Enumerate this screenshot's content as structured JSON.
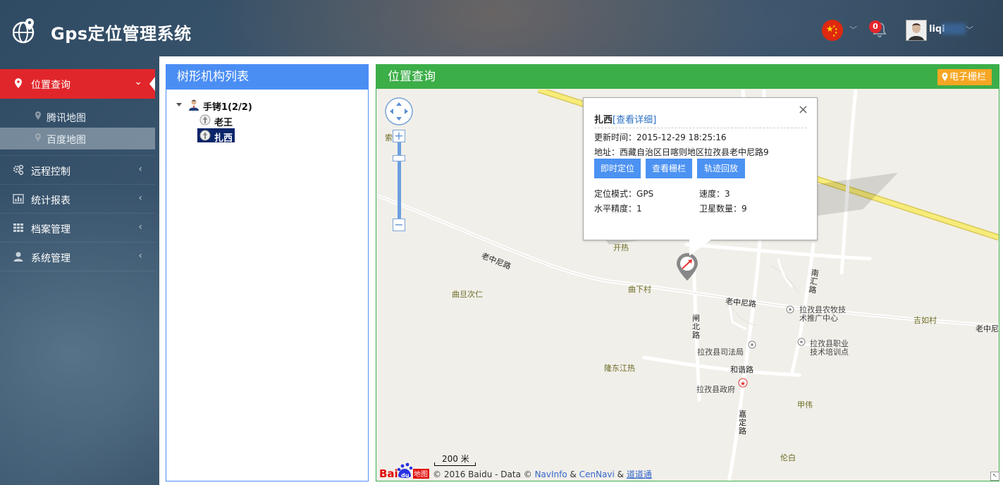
{
  "header": {
    "title": "Gps定位管理系统",
    "notification_count": "0",
    "user_name": "liqi",
    "icons": {
      "logo": "globe-pin-icon",
      "language": "china-flag-icon",
      "notifications": "bell-icon"
    }
  },
  "sidebar": {
    "items": [
      {
        "label": "位置查询",
        "icon": "map-marker-icon",
        "active": true,
        "children": [
          {
            "label": "腾讯地图"
          },
          {
            "label": "百度地图",
            "selected": true
          }
        ]
      },
      {
        "label": "远程控制",
        "icon": "gears-icon"
      },
      {
        "label": "统计报表",
        "icon": "bar-chart-icon"
      },
      {
        "label": "档案管理",
        "icon": "grid-icon"
      },
      {
        "label": "系统管理",
        "icon": "user-icon"
      }
    ]
  },
  "tree_panel": {
    "title": "树形机构列表",
    "root": {
      "label": "手铐1(2/2)"
    },
    "children": [
      {
        "label": "老王"
      },
      {
        "label": "扎西",
        "selected": true
      }
    ]
  },
  "map_panel": {
    "title": "位置查询",
    "fence_button": "电子栅栏",
    "labels": {
      "kaire": "开热",
      "laozhongni_road_1": "老中尼路",
      "laozhongni_road_2": "老中尼路",
      "laozhongni_road_3": "老中尼",
      "qiequ_ciren": "曲旦次仁",
      "quxia_cun": "曲下村",
      "zhabei_road": "闸北路",
      "nanhui_road": "南汇路",
      "agri_center": "拉孜县农牧技术推广中心",
      "jiru_cun": "吉如村",
      "justice_bureau": "拉孜县司法局",
      "vocational_center": "拉孜县职业技术培训点",
      "longdong_jiangre": "隆东江热",
      "hexie_road": "和谐路",
      "county_government": "拉孜县政府",
      "jiawei": "甲伟",
      "jiading_road": "嘉定路",
      "lunbai": "伦白",
      "suo": "索"
    },
    "scale": "200 米",
    "copyright_prefix": "© 2016 Baidu - Data © ",
    "copyright_navinfo": "NavInfo",
    "copyright_amp": " & ",
    "copyright_cennavi": "CenNavi",
    "copyright_amp2": " & ",
    "copyright_daodaotong": "道道通",
    "logo_text": "Bai地图"
  },
  "popup": {
    "name": "扎西",
    "detail_link": "[查看详细]",
    "update_time_label": "更新时间：",
    "update_time": "2015-12-29 18:25:16",
    "address_label": "地址：",
    "address": "西藏自治区日喀则地区拉孜县老中尼路9",
    "buttons": [
      "即时定位",
      "查看栅栏",
      "轨迹回放"
    ],
    "mode_label": "定位模式：",
    "mode": "GPS",
    "speed_label": "速度：",
    "speed": "3",
    "precision_label": "水平精度：",
    "precision": "1",
    "satellites_label": "卫星数量：",
    "satellites": "9",
    "close": "×"
  }
}
